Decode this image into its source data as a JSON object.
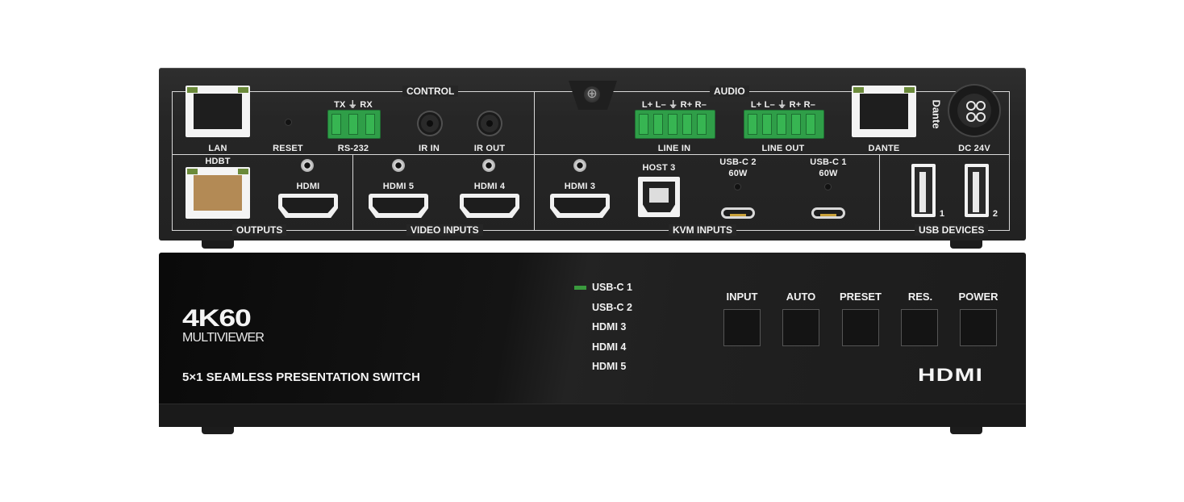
{
  "rear_panel": {
    "group_labels": {
      "control": "CONTROL",
      "audio": "AUDIO",
      "outputs": "OUTPUTS",
      "video_inputs": "VIDEO INPUTS",
      "kvm_inputs": "KVM INPUTS",
      "usb_devices": "USB DEVICES"
    },
    "port_labels": {
      "lan": "LAN",
      "reset": "RESET",
      "rs232": "RS-232",
      "rs232_pins": "TX ⏚ RX",
      "ir_in": "IR IN",
      "ir_out": "IR OUT",
      "line_in": "LINE IN",
      "line_in_pins": "L+ L– ⏚ R+ R–",
      "line_out": "LINE OUT",
      "line_out_pins": "L+ L– ⏚ R+ R–",
      "dante": "DANTE",
      "dante_logo": "Dante",
      "dc": "DC 24V",
      "hdbt": "HDBT",
      "hdmi_out": "HDMI",
      "hdmi5": "HDMI 5",
      "hdmi4": "HDMI 4",
      "hdmi3": "HDMI 3",
      "host3": "HOST 3",
      "usbc2": "USB-C 2",
      "usbc2_power": "60W",
      "usbc1": "USB-C 1",
      "usbc1_power": "60W",
      "usb1": "1",
      "usb2": "2"
    }
  },
  "front_panel": {
    "brand_main": "4K60",
    "brand_sub": "MULTIVIEWER",
    "product_name": "5×1 SEAMLESS PRESENTATION SWITCH",
    "hdmi_logo": "HDMI",
    "sources": [
      {
        "label": "USB-C 1",
        "active": true
      },
      {
        "label": "USB-C 2",
        "active": false
      },
      {
        "label": "HDMI 3",
        "active": false
      },
      {
        "label": "HDMI 4",
        "active": false
      },
      {
        "label": "HDMI 5",
        "active": false
      }
    ],
    "buttons": [
      {
        "label": "INPUT"
      },
      {
        "label": "AUTO"
      },
      {
        "label": "PRESET"
      },
      {
        "label": "RES."
      },
      {
        "label": "POWER"
      }
    ],
    "led_color": "#3a9a3e"
  }
}
